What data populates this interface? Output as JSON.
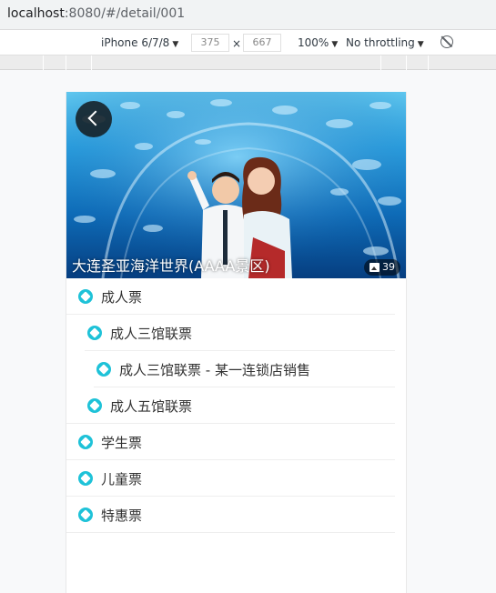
{
  "browser": {
    "address": {
      "host": "localhost",
      "path": ":8080/#/detail/001"
    }
  },
  "devtools": {
    "device": "iPhone 6/7/8",
    "width": "375",
    "times": "×",
    "height": "667",
    "zoom": "100%",
    "throttling": "No throttling",
    "rotate_icon": "rotate-icon"
  },
  "detail": {
    "title": "大连圣亚海洋世界(AAAA景区)",
    "photo_count": "39",
    "back_icon": "chevron-left-icon"
  },
  "tickets": [
    {
      "label": "成人票",
      "level": 0
    },
    {
      "label": "成人三馆联票",
      "level": 1
    },
    {
      "label": "成人三馆联票 - 某一连锁店销售",
      "level": 2
    },
    {
      "label": "成人五馆联票",
      "level": 1
    },
    {
      "label": "学生票",
      "level": 0
    },
    {
      "label": "儿童票",
      "level": 0
    },
    {
      "label": "特惠票",
      "level": 0
    }
  ],
  "colors": {
    "ticket_icon": "#1ec2d8",
    "text": "#333333"
  }
}
